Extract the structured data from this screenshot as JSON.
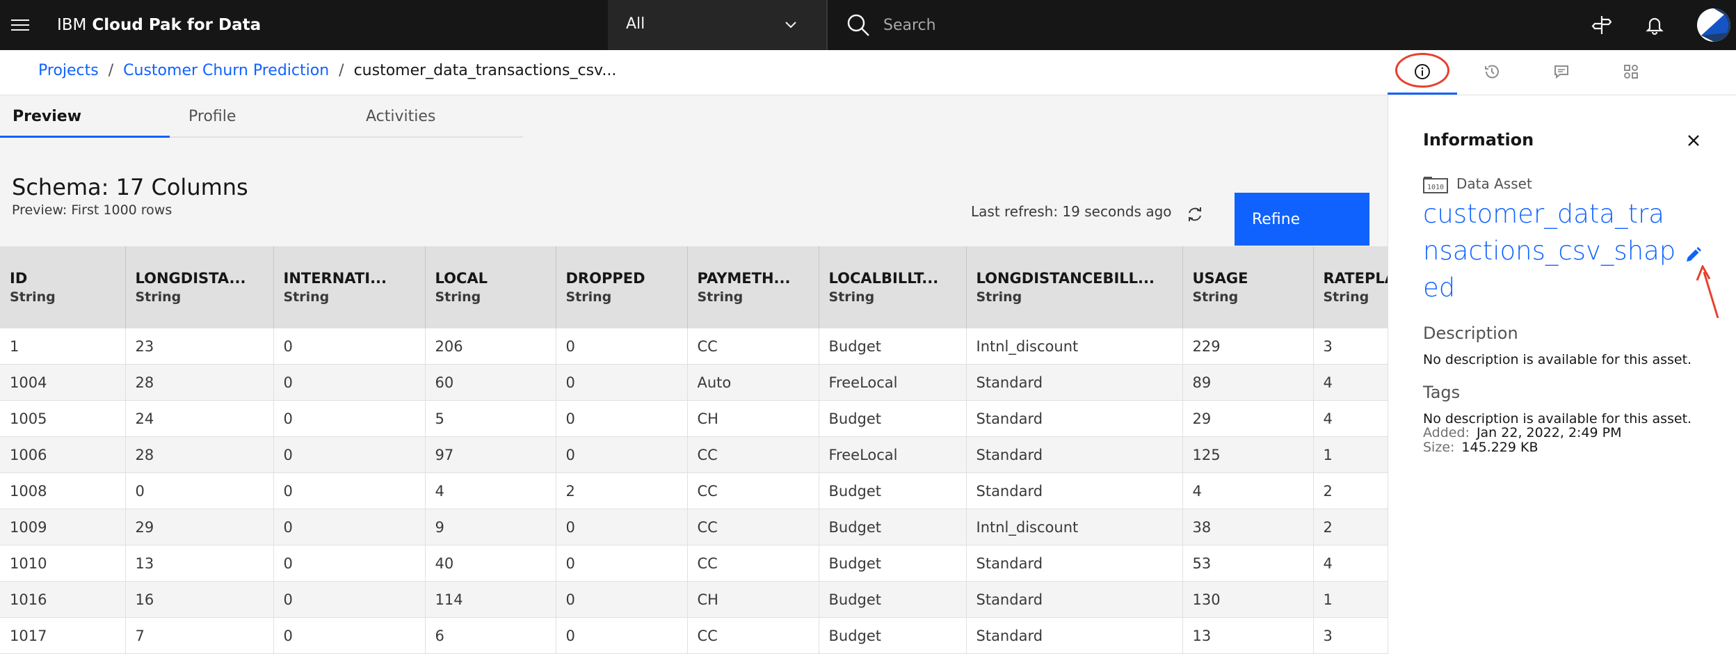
{
  "header": {
    "brand_prefix": "IBM",
    "brand_product": "Cloud Pak for Data",
    "scope": "All",
    "search_placeholder": "Search"
  },
  "breadcrumb": {
    "items": [
      "Projects",
      "Customer Churn Prediction"
    ],
    "separator": "/",
    "current": "customer_data_transactions_csv..."
  },
  "tabs": [
    "Preview",
    "Profile",
    "Activities"
  ],
  "schema": {
    "title": "Schema:  17 Columns",
    "subtitle": "Preview: First 1000 rows",
    "last_refresh": "Last refresh: 19 seconds ago",
    "refine_label": "Refine"
  },
  "table": {
    "columns": [
      {
        "name": "ID",
        "type": "String"
      },
      {
        "name": "LONGDISTA...",
        "type": "String"
      },
      {
        "name": "INTERNATI...",
        "type": "String"
      },
      {
        "name": "LOCAL",
        "type": "String"
      },
      {
        "name": "DROPPED",
        "type": "String"
      },
      {
        "name": "PAYMETH...",
        "type": "String"
      },
      {
        "name": "LOCALBILLT...",
        "type": "String"
      },
      {
        "name": "LONGDISTANCEBILL...",
        "type": "String"
      },
      {
        "name": "USAGE",
        "type": "String"
      },
      {
        "name": "RATEPLAN",
        "type": "String"
      }
    ],
    "rows": [
      [
        "1",
        "23",
        "0",
        "206",
        "0",
        "CC",
        "Budget",
        "Intnl_discount",
        "229",
        "3"
      ],
      [
        "1004",
        "28",
        "0",
        "60",
        "0",
        "Auto",
        "FreeLocal",
        "Standard",
        "89",
        "4"
      ],
      [
        "1005",
        "24",
        "0",
        "5",
        "0",
        "CH",
        "Budget",
        "Standard",
        "29",
        "4"
      ],
      [
        "1006",
        "28",
        "0",
        "97",
        "0",
        "CC",
        "FreeLocal",
        "Standard",
        "125",
        "1"
      ],
      [
        "1008",
        "0",
        "0",
        "4",
        "2",
        "CC",
        "Budget",
        "Standard",
        "4",
        "2"
      ],
      [
        "1009",
        "29",
        "0",
        "9",
        "0",
        "CC",
        "Budget",
        "Intnl_discount",
        "38",
        "2"
      ],
      [
        "1010",
        "13",
        "0",
        "40",
        "0",
        "CC",
        "Budget",
        "Standard",
        "53",
        "4"
      ],
      [
        "1016",
        "16",
        "0",
        "114",
        "0",
        "CH",
        "Budget",
        "Standard",
        "130",
        "1"
      ],
      [
        "1017",
        "7",
        "0",
        "6",
        "0",
        "CC",
        "Budget",
        "Standard",
        "13",
        "3"
      ]
    ]
  },
  "panel": {
    "tab_icons": [
      "information-icon",
      "history-icon",
      "chat-icon",
      "apps-icon"
    ],
    "title": "Information",
    "asset_type": "Data Asset",
    "asset_name": "customer_data_transactions_csv_shaped",
    "description_label": "Description",
    "description_text": "No description is available for this asset.",
    "tags_label": "Tags",
    "tags_text": "No description is available for this asset.",
    "added_key": "Added:",
    "added_value": "Jan 22, 2022, 2:49 PM",
    "size_key": "Size:",
    "size_value": "145.229 KB"
  },
  "colors": {
    "header_bg": "#161616",
    "accent": "#0f62fe",
    "annotation": "#e5412d"
  }
}
